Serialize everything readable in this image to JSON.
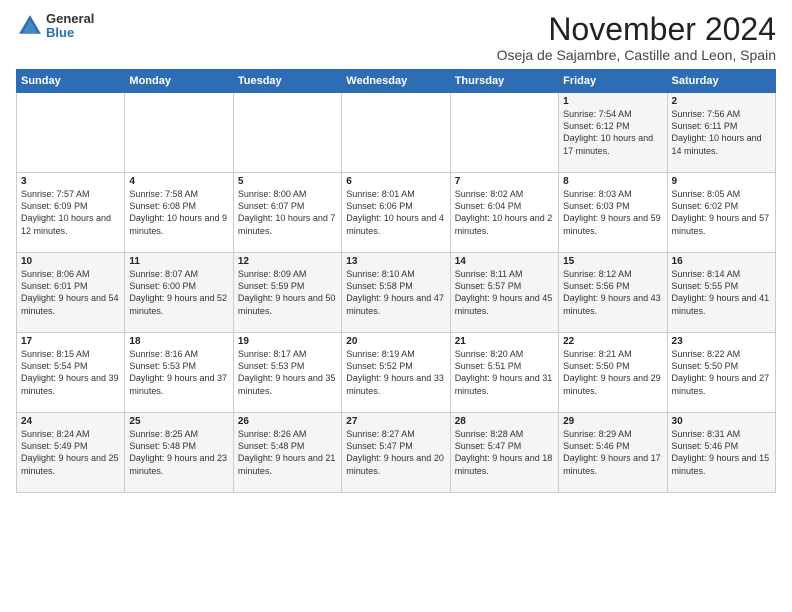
{
  "logo": {
    "general": "General",
    "blue": "Blue"
  },
  "title": "November 2024",
  "subtitle": "Oseja de Sajambre, Castille and Leon, Spain",
  "days_of_week": [
    "Sunday",
    "Monday",
    "Tuesday",
    "Wednesday",
    "Thursday",
    "Friday",
    "Saturday"
  ],
  "weeks": [
    [
      {
        "day": "",
        "info": ""
      },
      {
        "day": "",
        "info": ""
      },
      {
        "day": "",
        "info": ""
      },
      {
        "day": "",
        "info": ""
      },
      {
        "day": "",
        "info": ""
      },
      {
        "day": "1",
        "info": "Sunrise: 7:54 AM\nSunset: 6:12 PM\nDaylight: 10 hours and 17 minutes."
      },
      {
        "day": "2",
        "info": "Sunrise: 7:56 AM\nSunset: 6:11 PM\nDaylight: 10 hours and 14 minutes."
      }
    ],
    [
      {
        "day": "3",
        "info": "Sunrise: 7:57 AM\nSunset: 6:09 PM\nDaylight: 10 hours and 12 minutes."
      },
      {
        "day": "4",
        "info": "Sunrise: 7:58 AM\nSunset: 6:08 PM\nDaylight: 10 hours and 9 minutes."
      },
      {
        "day": "5",
        "info": "Sunrise: 8:00 AM\nSunset: 6:07 PM\nDaylight: 10 hours and 7 minutes."
      },
      {
        "day": "6",
        "info": "Sunrise: 8:01 AM\nSunset: 6:06 PM\nDaylight: 10 hours and 4 minutes."
      },
      {
        "day": "7",
        "info": "Sunrise: 8:02 AM\nSunset: 6:04 PM\nDaylight: 10 hours and 2 minutes."
      },
      {
        "day": "8",
        "info": "Sunrise: 8:03 AM\nSunset: 6:03 PM\nDaylight: 9 hours and 59 minutes."
      },
      {
        "day": "9",
        "info": "Sunrise: 8:05 AM\nSunset: 6:02 PM\nDaylight: 9 hours and 57 minutes."
      }
    ],
    [
      {
        "day": "10",
        "info": "Sunrise: 8:06 AM\nSunset: 6:01 PM\nDaylight: 9 hours and 54 minutes."
      },
      {
        "day": "11",
        "info": "Sunrise: 8:07 AM\nSunset: 6:00 PM\nDaylight: 9 hours and 52 minutes."
      },
      {
        "day": "12",
        "info": "Sunrise: 8:09 AM\nSunset: 5:59 PM\nDaylight: 9 hours and 50 minutes."
      },
      {
        "day": "13",
        "info": "Sunrise: 8:10 AM\nSunset: 5:58 PM\nDaylight: 9 hours and 47 minutes."
      },
      {
        "day": "14",
        "info": "Sunrise: 8:11 AM\nSunset: 5:57 PM\nDaylight: 9 hours and 45 minutes."
      },
      {
        "day": "15",
        "info": "Sunrise: 8:12 AM\nSunset: 5:56 PM\nDaylight: 9 hours and 43 minutes."
      },
      {
        "day": "16",
        "info": "Sunrise: 8:14 AM\nSunset: 5:55 PM\nDaylight: 9 hours and 41 minutes."
      }
    ],
    [
      {
        "day": "17",
        "info": "Sunrise: 8:15 AM\nSunset: 5:54 PM\nDaylight: 9 hours and 39 minutes."
      },
      {
        "day": "18",
        "info": "Sunrise: 8:16 AM\nSunset: 5:53 PM\nDaylight: 9 hours and 37 minutes."
      },
      {
        "day": "19",
        "info": "Sunrise: 8:17 AM\nSunset: 5:53 PM\nDaylight: 9 hours and 35 minutes."
      },
      {
        "day": "20",
        "info": "Sunrise: 8:19 AM\nSunset: 5:52 PM\nDaylight: 9 hours and 33 minutes."
      },
      {
        "day": "21",
        "info": "Sunrise: 8:20 AM\nSunset: 5:51 PM\nDaylight: 9 hours and 31 minutes."
      },
      {
        "day": "22",
        "info": "Sunrise: 8:21 AM\nSunset: 5:50 PM\nDaylight: 9 hours and 29 minutes."
      },
      {
        "day": "23",
        "info": "Sunrise: 8:22 AM\nSunset: 5:50 PM\nDaylight: 9 hours and 27 minutes."
      }
    ],
    [
      {
        "day": "24",
        "info": "Sunrise: 8:24 AM\nSunset: 5:49 PM\nDaylight: 9 hours and 25 minutes."
      },
      {
        "day": "25",
        "info": "Sunrise: 8:25 AM\nSunset: 5:48 PM\nDaylight: 9 hours and 23 minutes."
      },
      {
        "day": "26",
        "info": "Sunrise: 8:26 AM\nSunset: 5:48 PM\nDaylight: 9 hours and 21 minutes."
      },
      {
        "day": "27",
        "info": "Sunrise: 8:27 AM\nSunset: 5:47 PM\nDaylight: 9 hours and 20 minutes."
      },
      {
        "day": "28",
        "info": "Sunrise: 8:28 AM\nSunset: 5:47 PM\nDaylight: 9 hours and 18 minutes."
      },
      {
        "day": "29",
        "info": "Sunrise: 8:29 AM\nSunset: 5:46 PM\nDaylight: 9 hours and 17 minutes."
      },
      {
        "day": "30",
        "info": "Sunrise: 8:31 AM\nSunset: 5:46 PM\nDaylight: 9 hours and 15 minutes."
      }
    ]
  ]
}
